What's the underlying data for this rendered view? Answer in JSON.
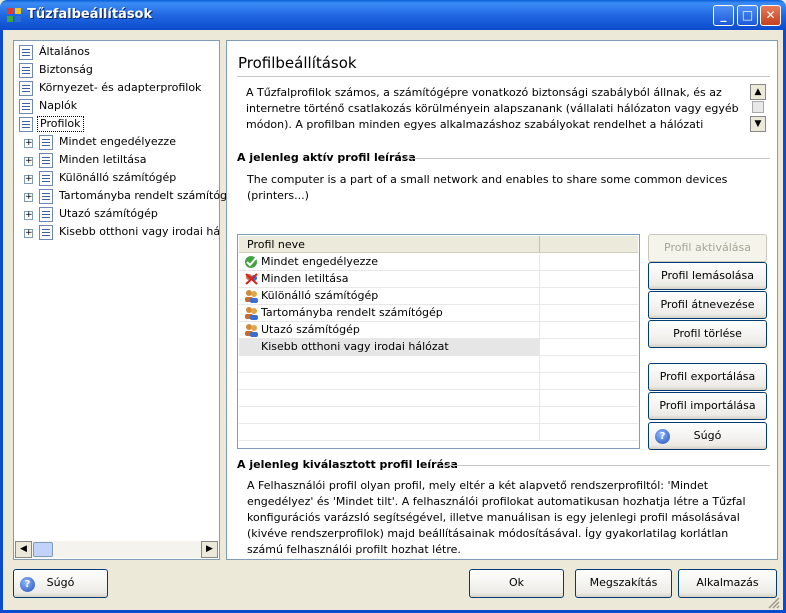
{
  "window": {
    "title": "Tűzfalbeállítások",
    "min_glyph": "_",
    "max_glyph": "□",
    "close_glyph": "✕"
  },
  "tree": {
    "items": [
      {
        "label": "Általános",
        "icon": "list-icon"
      },
      {
        "label": "Biztonság",
        "icon": "list-icon"
      },
      {
        "label": "Környezet- és adapterprofilok",
        "icon": "list-icon"
      },
      {
        "label": "Naplók",
        "icon": "list-icon"
      },
      {
        "label": "Profilok",
        "icon": "list-icon",
        "selected": true
      }
    ],
    "children": [
      {
        "label": "Mindet engedélyezze",
        "expander": "+"
      },
      {
        "label": "Minden letiltása",
        "expander": "+"
      },
      {
        "label": "Különálló számítógép",
        "expander": "+"
      },
      {
        "label": "Tartományba rendelt számítógép",
        "expander": "+"
      },
      {
        "label": "Utazó számítógép",
        "expander": "+"
      },
      {
        "label": "Kisebb otthoni vagy irodai hálóza",
        "expander": "+"
      }
    ],
    "scroll_left": "◀",
    "scroll_right": "▶"
  },
  "main": {
    "heading": "Profilbeállítások",
    "description": "A Tűzfalprofilok számos, a számítógépre vonatkozó biztonsági szabályból állnak, és az internetre történő csatlakozás körülményein alapszanank (vállalati hálózaton vagy egyéb módon). A profilban minden egyes alkalmazáshoz szabályokat rendelhet a hálózati kommunikáció szempontjából",
    "scroll_up": "▲",
    "scroll_down": "▼",
    "active_title": "A jelenleg aktív profil leírása",
    "active_text": "The computer is a part of a small network and enables to share some common devices (printers...)",
    "list_header": "Profil neve",
    "profiles": [
      {
        "name": "Mindet engedélyezze",
        "icon": "allow-all-icon"
      },
      {
        "name": "Minden letiltása",
        "icon": "block-all-icon"
      },
      {
        "name": "Különálló számítógép",
        "icon": "users-icon"
      },
      {
        "name": "Tartományba rendelt számítógép",
        "icon": "users-icon"
      },
      {
        "name": "Utazó számítógép",
        "icon": "users-icon"
      },
      {
        "name": "Kisebb otthoni vagy irodai hálózat",
        "icon": "users-icon",
        "selected": true
      }
    ],
    "buttons": {
      "activate": "Profil aktiválása",
      "duplicate": "Profil lemásolása",
      "rename": "Profil átnevezése",
      "delete": "Profil törlése",
      "export": "Profil exportálása",
      "import": "Profil importálása",
      "help": "Súgó"
    },
    "selected_title": "A jelenleg kiválasztott profil leírása",
    "selected_text": "A Felhasználói profil olyan profil, mely eltér a két alapvető rendszerprofiltól: 'Mindet engedélyez' és 'Mindet tilt'. A felhasználói profilokat automatikusan hozhatja létre a Tűzfal konfigurációs varázsló segítségével, illetve manuálisan is egy jelenlegi profil másolásával (kivéve rendszerprofilok) majd beállításainak módosításával. Így gyakorlatilag korlátlan számú felhasználói profilt hozhat létre."
  },
  "footer": {
    "help": "Súgó",
    "ok": "Ok",
    "cancel": "Megszakítás",
    "apply": "Alkalmazás"
  },
  "colors": {
    "titlebar": "#1f64e0",
    "window_bg": "#ece9d8",
    "border": "#7f9db9"
  }
}
